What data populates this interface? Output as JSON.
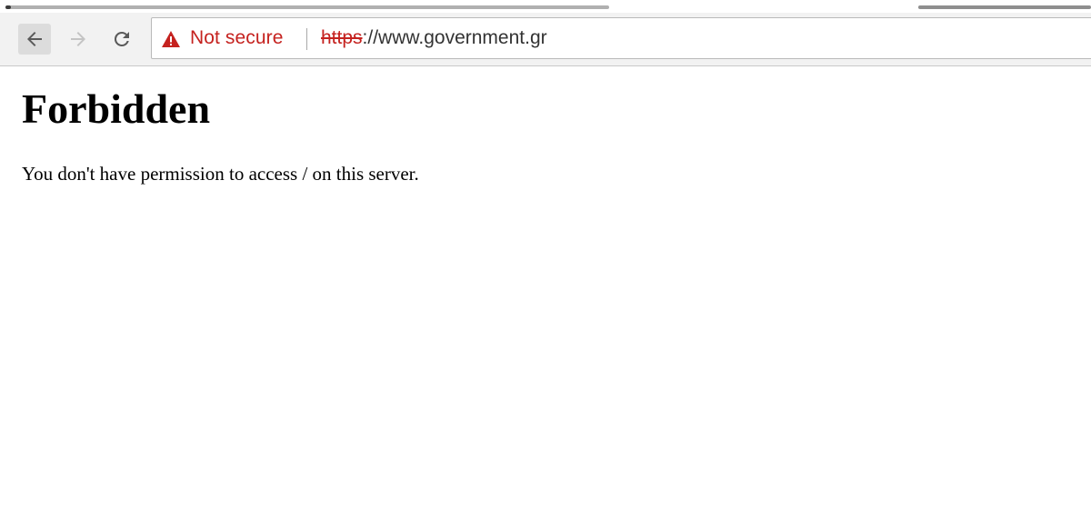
{
  "browser": {
    "security_label": "Not secure",
    "url_scheme": "https",
    "url_rest": "://www.government.gr",
    "icons": {
      "back": "back-arrow-icon",
      "forward": "forward-arrow-icon",
      "reload": "reload-icon",
      "warning": "warning-triangle-icon"
    },
    "colors": {
      "warning": "#c5221f",
      "toolbar": "#f2f2f2"
    }
  },
  "page": {
    "heading": "Forbidden",
    "message": "You don't have permission to access / on this server."
  }
}
